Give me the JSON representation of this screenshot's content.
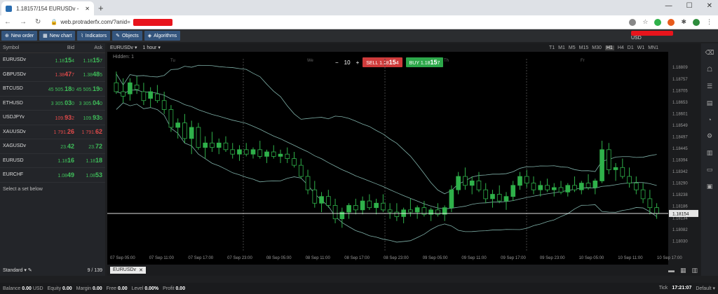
{
  "browser": {
    "tab_title": "1.18157/154 EURUSDv - P",
    "url": "web.protraderfx.com/?anid=",
    "new_tab": "+"
  },
  "toolbar": {
    "new_order": "New order",
    "new_chart": "New chart",
    "indicators": "Indicators",
    "objects": "Objects",
    "algorithms": "Algorithms",
    "account_currency": "USD"
  },
  "watchlist": {
    "headers": {
      "symbol": "Symbol",
      "bid": "Bid",
      "ask": "Ask"
    },
    "rows": [
      {
        "symbol": "EURUSDv",
        "bid_a": "1.18",
        "bid_b": "15",
        "bid_c": "4",
        "ask_a": "1.18",
        "ask_b": "15",
        "ask_c": "7",
        "dir": "up"
      },
      {
        "symbol": "GBPUSDv",
        "bid_a": "1.38",
        "bid_b": "47",
        "bid_c": "7",
        "ask_a": "1.38",
        "ask_b": "48",
        "ask_c": "5",
        "dir": "mix"
      },
      {
        "symbol": "BTCUSD",
        "bid_a": "45 505.",
        "bid_b": "18",
        "bid_c": "0",
        "ask_a": "45 505.",
        "ask_b": "19",
        "ask_c": "0",
        "dir": "up"
      },
      {
        "symbol": "ETHUSD",
        "bid_a": "3 305.",
        "bid_b": "03",
        "bid_c": "0",
        "ask_a": "3 305.",
        "ask_b": "04",
        "ask_c": "0",
        "dir": "up"
      },
      {
        "symbol": "USDJPYv",
        "bid_a": "109.",
        "bid_b": "93",
        "bid_c": "2",
        "ask_a": "109.",
        "ask_b": "93",
        "ask_c": "5",
        "dir": "mix"
      },
      {
        "symbol": "XAUUSDv",
        "bid_a": "1 791.",
        "bid_b": "26",
        "bid_c": "",
        "ask_a": "1 791.",
        "ask_b": "62",
        "ask_c": "",
        "dir": "dn"
      },
      {
        "symbol": "XAGUSDv",
        "bid_a": "23.",
        "bid_b": "42",
        "bid_c": "",
        "ask_a": "23.",
        "ask_b": "72",
        "ask_c": "",
        "dir": "up"
      },
      {
        "symbol": "EURUSD",
        "bid_a": "1.18",
        "bid_b": "16",
        "bid_c": "",
        "ask_a": "1.18",
        "ask_b": "18",
        "ask_c": "",
        "dir": "up"
      },
      {
        "symbol": "EURCHF",
        "bid_a": "1.08",
        "bid_b": "49",
        "bid_c": "",
        "ask_a": "1.08",
        "ask_b": "53",
        "ask_c": "",
        "dir": "up"
      }
    ],
    "footer": "Select a set below",
    "set_name": "Standard",
    "count": "9 / 139"
  },
  "chart": {
    "symbol": "EURUSDv",
    "timeframe": "1 hour",
    "hidden_label": "Hidden: 1",
    "quantity": "10",
    "sell_label": "SELL",
    "sell_price_a": "1.18",
    "sell_price_b": "15",
    "sell_price_c": "4",
    "buy_label": "BUY",
    "buy_price_a": "1.18",
    "buy_price_b": "15",
    "buy_price_c": "7",
    "timeframes": [
      "T1",
      "M1",
      "M5",
      "M15",
      "M30",
      "H1",
      "H4",
      "D1",
      "W1",
      "MN1"
    ],
    "selected_tf": "H1",
    "bottom_tab": "EURUSDv"
  },
  "chart_data": {
    "type": "candlestick",
    "y_ticks": [
      "1.18809",
      "1.18757",
      "1.18705",
      "1.18653",
      "1.18601",
      "1.18549",
      "1.18497",
      "1.18445",
      "1.18394",
      "1.18342",
      "1.18290",
      "1.18238",
      "1.18186",
      "1.18134",
      "1.18082",
      "1.18030"
    ],
    "x_ticks": [
      "07 Sep 05:00",
      "07 Sep 11:00",
      "07 Sep 17:00",
      "07 Sep 23:00",
      "08 Sep 05:00",
      "08 Sep 11:00",
      "08 Sep 17:00",
      "08 Sep 23:00",
      "09 Sep 05:00",
      "09 Sep 11:00",
      "09 Sep 17:00",
      "09 Sep 23:00",
      "10 Sep 05:00",
      "10 Sep 11:00",
      "10 Sep 17:00"
    ],
    "day_labels": [
      "Tu",
      "We",
      "Th",
      "Fr"
    ],
    "current_price": "1.18154",
    "ylim": [
      1.18,
      1.1886
    ],
    "candles": [
      [
        1.1874,
        1.1879,
        1.1869,
        1.187
      ],
      [
        1.187,
        1.1876,
        1.1865,
        1.1868
      ],
      [
        1.1869,
        1.1876,
        1.1866,
        1.1874
      ],
      [
        1.1873,
        1.1877,
        1.1869,
        1.1871
      ],
      [
        1.187,
        1.1874,
        1.1864,
        1.1866
      ],
      [
        1.1867,
        1.1872,
        1.1863,
        1.187
      ],
      [
        1.1869,
        1.1873,
        1.1865,
        1.1866
      ],
      [
        1.1866,
        1.187,
        1.186,
        1.1862
      ],
      [
        1.1862,
        1.1864,
        1.1852,
        1.1854
      ],
      [
        1.1854,
        1.1858,
        1.1849,
        1.1856
      ],
      [
        1.1856,
        1.186,
        1.1847,
        1.1849
      ],
      [
        1.1849,
        1.1857,
        1.1842,
        1.1854
      ],
      [
        1.1854,
        1.1856,
        1.1844,
        1.1845
      ],
      [
        1.1845,
        1.185,
        1.184,
        1.1847
      ],
      [
        1.1847,
        1.1852,
        1.1843,
        1.1845
      ],
      [
        1.1845,
        1.1849,
        1.1842,
        1.1847
      ],
      [
        1.1847,
        1.185,
        1.1843,
        1.1844
      ],
      [
        1.1844,
        1.1847,
        1.184,
        1.1842
      ],
      [
        1.1842,
        1.1846,
        1.1839,
        1.1844
      ],
      [
        1.1844,
        1.1847,
        1.1841,
        1.1842
      ],
      [
        1.1842,
        1.1845,
        1.184,
        1.1844
      ],
      [
        1.1844,
        1.1848,
        1.184,
        1.1841
      ],
      [
        1.1841,
        1.1844,
        1.1838,
        1.1843
      ],
      [
        1.1843,
        1.1846,
        1.184,
        1.1841
      ],
      [
        1.1841,
        1.1844,
        1.1838,
        1.1842
      ],
      [
        1.1842,
        1.1845,
        1.1838,
        1.184
      ],
      [
        1.184,
        1.1843,
        1.1836,
        1.1837
      ],
      [
        1.1837,
        1.184,
        1.1831,
        1.1832
      ],
      [
        1.1832,
        1.1835,
        1.1824,
        1.1826
      ],
      [
        1.1826,
        1.183,
        1.1818,
        1.182
      ],
      [
        1.182,
        1.1825,
        1.1816,
        1.1823
      ],
      [
        1.1823,
        1.1826,
        1.1818,
        1.1819
      ],
      [
        1.1819,
        1.1822,
        1.1811,
        1.1813
      ],
      [
        1.1813,
        1.1818,
        1.1809,
        1.1816
      ],
      [
        1.1816,
        1.182,
        1.1813,
        1.1819
      ],
      [
        1.1819,
        1.1822,
        1.1815,
        1.1817
      ],
      [
        1.1817,
        1.1823,
        1.1815,
        1.1821
      ],
      [
        1.1821,
        1.1824,
        1.1817,
        1.1818
      ],
      [
        1.1818,
        1.1822,
        1.1815,
        1.182
      ],
      [
        1.182,
        1.1824,
        1.1816,
        1.1817
      ],
      [
        1.1817,
        1.182,
        1.1813,
        1.1816
      ],
      [
        1.1816,
        1.182,
        1.1812,
        1.1814
      ],
      [
        1.1814,
        1.1818,
        1.1811,
        1.1817
      ],
      [
        1.1817,
        1.1822,
        1.1814,
        1.1816
      ],
      [
        1.1816,
        1.1819,
        1.1813,
        1.1818
      ],
      [
        1.1818,
        1.1821,
        1.1814,
        1.1815
      ],
      [
        1.1815,
        1.1818,
        1.1812,
        1.1817
      ],
      [
        1.1817,
        1.182,
        1.1814,
        1.1815
      ],
      [
        1.1815,
        1.1819,
        1.1812,
        1.1818
      ],
      [
        1.1818,
        1.1828,
        1.1816,
        1.1826
      ],
      [
        1.1826,
        1.1834,
        1.1824,
        1.1832
      ],
      [
        1.1832,
        1.1836,
        1.1826,
        1.1828
      ],
      [
        1.1828,
        1.1832,
        1.1824,
        1.183
      ],
      [
        1.183,
        1.1834,
        1.1825,
        1.1826
      ],
      [
        1.1826,
        1.1829,
        1.182,
        1.1822
      ],
      [
        1.1822,
        1.1826,
        1.1818,
        1.1824
      ],
      [
        1.1824,
        1.1828,
        1.182,
        1.1821
      ],
      [
        1.1821,
        1.1825,
        1.1817,
        1.1823
      ],
      [
        1.1823,
        1.183,
        1.1821,
        1.1828
      ],
      [
        1.1828,
        1.1834,
        1.1826,
        1.1832
      ],
      [
        1.1832,
        1.1835,
        1.1827,
        1.1829
      ],
      [
        1.1829,
        1.1832,
        1.1824,
        1.1826
      ],
      [
        1.1826,
        1.183,
        1.1823,
        1.1828
      ],
      [
        1.1828,
        1.1831,
        1.1825,
        1.1826
      ],
      [
        1.1826,
        1.1829,
        1.1823,
        1.1827
      ],
      [
        1.1827,
        1.183,
        1.1824,
        1.1825
      ],
      [
        1.1825,
        1.1829,
        1.1823,
        1.1828
      ],
      [
        1.1828,
        1.1832,
        1.1825,
        1.1826
      ],
      [
        1.1826,
        1.183,
        1.1824,
        1.1829
      ],
      [
        1.1829,
        1.1833,
        1.1826,
        1.1827
      ],
      [
        1.1827,
        1.1831,
        1.1824,
        1.183
      ],
      [
        1.183,
        1.1848,
        1.1829,
        1.1844
      ],
      [
        1.1844,
        1.1847,
        1.1833,
        1.1835
      ],
      [
        1.1835,
        1.1838,
        1.183,
        1.1836
      ],
      [
        1.1836,
        1.184,
        1.1831,
        1.1832
      ],
      [
        1.1832,
        1.1836,
        1.1827,
        1.1829
      ],
      [
        1.1829,
        1.1832,
        1.1824,
        1.1826
      ],
      [
        1.1826,
        1.1829,
        1.182,
        1.1822
      ],
      [
        1.1822,
        1.1826,
        1.1815,
        1.1818
      ],
      [
        1.1818,
        1.182,
        1.1813,
        1.18154
      ]
    ]
  },
  "status": {
    "balance_label": "Balance",
    "balance": "0.00",
    "balance_cur": "USD",
    "equity_label": "Equity",
    "equity": "0.00",
    "margin_label": "Margin",
    "margin": "0.00",
    "free_label": "Free",
    "free": "0.00",
    "level_label": "Level",
    "level": "0.00%",
    "profit_label": "Profit",
    "profit": "0.00",
    "tick_label": "Tick",
    "time": "17:21:07",
    "tz": "Default"
  },
  "colors": {
    "bull": "#2fb14a",
    "bear": "#2fb14a",
    "band": "#7fb0a8",
    "price_line": "#ffffff"
  }
}
